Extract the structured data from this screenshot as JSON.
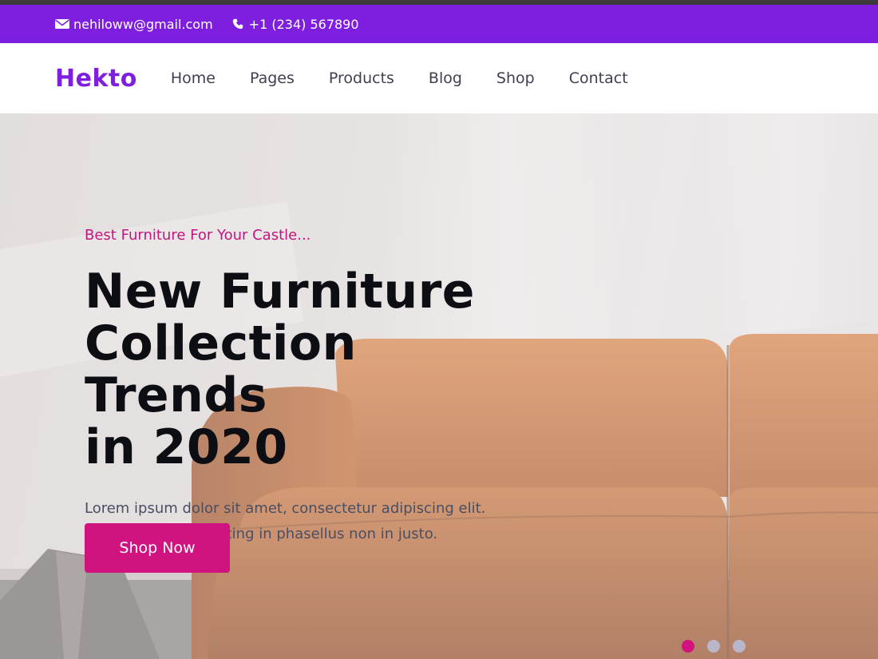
{
  "topbar": {
    "email": "nehiloww@gmail.com",
    "phone": "+1 (234) 567890",
    "email_icon": "envelope-icon",
    "phone_icon": "phone-icon"
  },
  "nav": {
    "logo": "Hekto",
    "links": [
      "Home",
      "Pages",
      "Products",
      "Blog",
      "Shop",
      "Contact"
    ]
  },
  "hero": {
    "subtitle": "Best Furniture For Your Castle...",
    "headline_lines": [
      "New Furniture",
      "Collection Trends",
      "in 2020"
    ],
    "body_lines": [
      "Lorem ipsum dolor sit amet, consectetur adipiscing elit.",
      "Magna in est adipiscing in phasellus non in justo."
    ],
    "cta_label": "Shop Now",
    "slides": 3,
    "active_slide": 1
  },
  "colors": {
    "brand": "#7E1FE0",
    "accent": "#D0137F",
    "dot_inactive": "#B9B6C9"
  }
}
